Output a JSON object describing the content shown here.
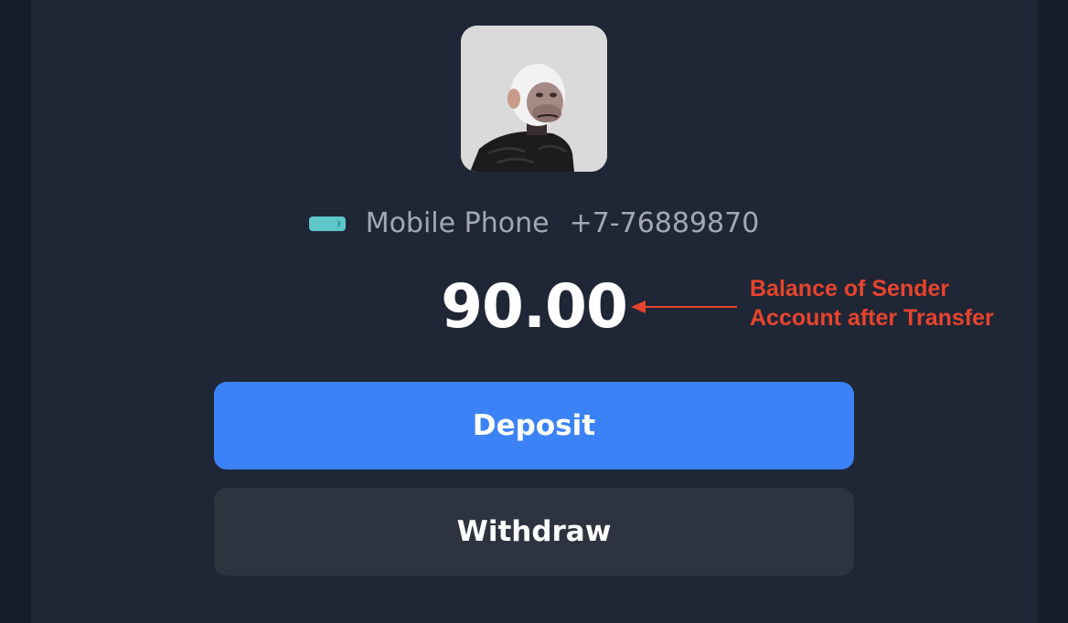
{
  "account": {
    "phone_label": "Mobile Phone",
    "phone_number": "+7-76889870",
    "balance": "90.00"
  },
  "actions": {
    "deposit_label": "Deposit",
    "withdraw_label": "Withdraw"
  },
  "annotation": {
    "line1": "Balance of Sender",
    "line2": "Account after Transfer"
  },
  "icons": {
    "avatar": "ape-avatar",
    "phone_type": "card-nfc-icon",
    "annotation_arrow": "arrow-left-icon"
  },
  "colors": {
    "panel_bg": "#1f2636",
    "deposit_bg": "#3b82f6",
    "withdraw_bg": "#2d3440",
    "annotation": "#e8442d",
    "card_icon": "#5ec7c9"
  }
}
